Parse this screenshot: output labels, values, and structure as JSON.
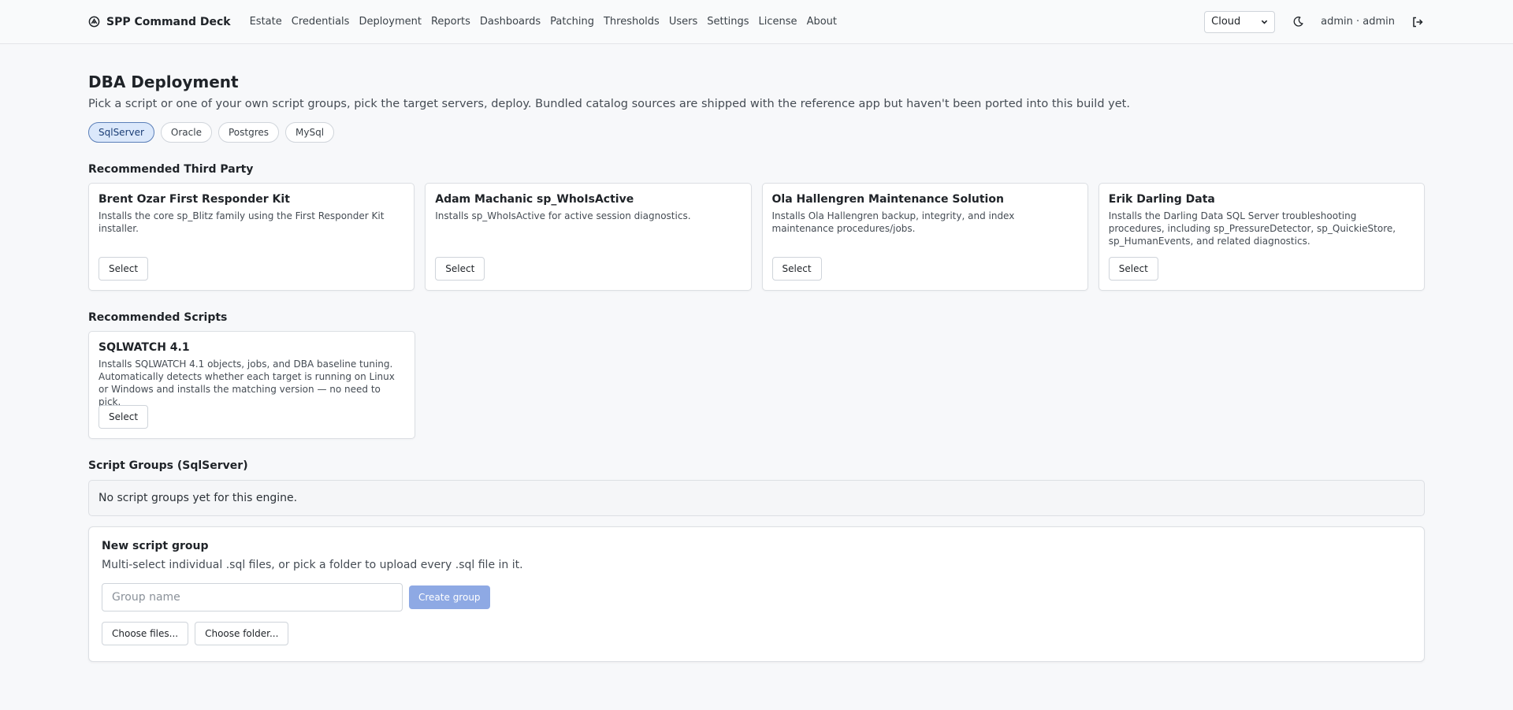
{
  "header": {
    "brand": "SPP Command Deck",
    "nav": [
      "Estate",
      "Credentials",
      "Deployment",
      "Reports",
      "Dashboards",
      "Patching",
      "Thresholds",
      "Users",
      "Settings",
      "License",
      "About"
    ],
    "environment_select": "Cloud",
    "user": "admin · admin"
  },
  "page": {
    "title": "DBA Deployment",
    "subtitle": "Pick a script or one of your own script groups, pick the target servers, deploy. Bundled catalog sources are shipped with the reference app but haven't been ported into this build yet.",
    "engines": [
      "SqlServer",
      "Oracle",
      "Postgres",
      "MySql"
    ],
    "active_engine": "SqlServer"
  },
  "third_party": {
    "title": "Recommended Third Party",
    "cards": [
      {
        "title": "Brent Ozar First Responder Kit",
        "desc": "Installs the core sp_Blitz family using the First Responder Kit installer.",
        "button": "Select"
      },
      {
        "title": "Adam Machanic sp_WhoIsActive",
        "desc": "Installs sp_WhoIsActive for active session diagnostics.",
        "button": "Select"
      },
      {
        "title": "Ola Hallengren Maintenance Solution",
        "desc": "Installs Ola Hallengren backup, integrity, and index maintenance procedures/jobs.",
        "button": "Select"
      },
      {
        "title": "Erik Darling Data",
        "desc": "Installs the Darling Data SQL Server troubleshooting procedures, including sp_PressureDetector, sp_QuickieStore, sp_HumanEvents, and related diagnostics.",
        "button": "Select"
      }
    ]
  },
  "scripts": {
    "title": "Recommended Scripts",
    "cards": [
      {
        "title": "SQLWATCH 4.1",
        "desc": "Installs SQLWATCH 4.1 objects, jobs, and DBA baseline tuning. Automatically detects whether each target is running on Linux or Windows and installs the matching version — no need to pick.",
        "button": "Select"
      }
    ]
  },
  "groups": {
    "title": "Script Groups (SqlServer)",
    "empty": "No script groups yet for this engine."
  },
  "new_group": {
    "title": "New script group",
    "subtitle": "Multi-select individual .sql files, or pick a folder to upload every .sql file in it.",
    "name_placeholder": "Group name",
    "create_label": "Create group",
    "choose_files": "Choose files...",
    "choose_folder": "Choose folder..."
  },
  "colors": {
    "accent": "#8ea9e4",
    "chip_active_bg": "#dbe8fb",
    "background": "#f7f8fa"
  }
}
